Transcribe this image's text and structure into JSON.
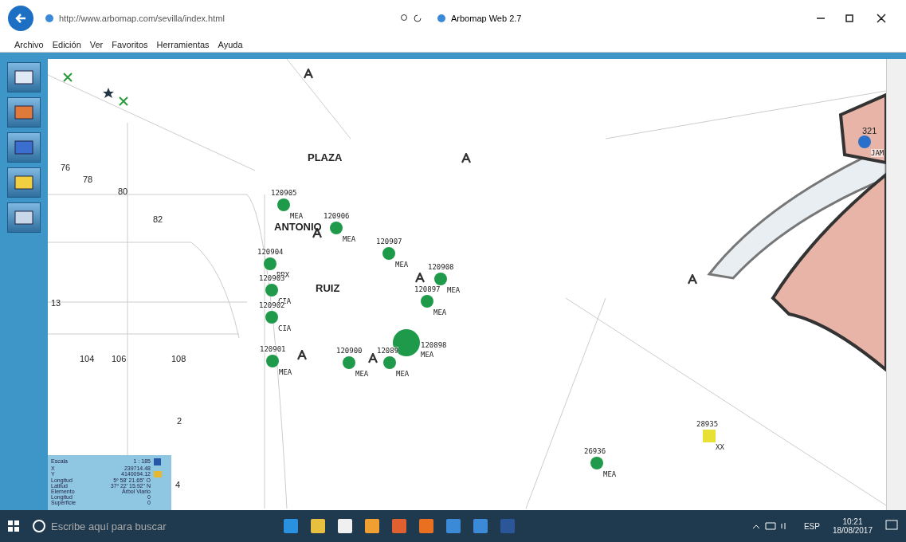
{
  "browser": {
    "address": "http://www.arbomap.com/sevilla/index.html",
    "tab_title": "Arbomap Web 2.7"
  },
  "menu": [
    "Archivo",
    "Edición",
    "Ver",
    "Favoritos",
    "Herramientas",
    "Ayuda"
  ],
  "map": {
    "labels": [
      {
        "kind": "street",
        "text": "PLAZA"
      },
      {
        "kind": "street",
        "text": "ANTONIO"
      },
      {
        "kind": "street",
        "text": "RUIZ"
      },
      {
        "kind": "number",
        "text": "76"
      },
      {
        "kind": "number",
        "text": "78"
      },
      {
        "kind": "number",
        "text": "80"
      },
      {
        "kind": "number",
        "text": "82"
      },
      {
        "kind": "number",
        "text": "13"
      },
      {
        "kind": "number",
        "text": "104"
      },
      {
        "kind": "number",
        "text": "106"
      },
      {
        "kind": "number",
        "text": "108"
      },
      {
        "kind": "number",
        "text": "2"
      },
      {
        "kind": "number",
        "text": "4"
      },
      {
        "kind": "number",
        "text": "321"
      }
    ],
    "trees": [
      {
        "kind": "circle",
        "id": "120905",
        "code": "MEA",
        "color": "#1f9a4a"
      },
      {
        "kind": "circle",
        "id": "120906",
        "code": "MEA",
        "color": "#1f9a4a"
      },
      {
        "kind": "circle",
        "id": "120907",
        "code": "MEA",
        "color": "#1f9a4a"
      },
      {
        "kind": "circle",
        "id": "120904",
        "code": "BRX",
        "color": "#1f9a4a"
      },
      {
        "kind": "circle",
        "id": "120903",
        "code": "CIA",
        "color": "#1f9a4a"
      },
      {
        "kind": "circle",
        "id": "120902",
        "code": "CIA",
        "color": "#1f9a4a"
      },
      {
        "kind": "circle",
        "id": "120908",
        "code": "MEA",
        "color": "#1f9a4a"
      },
      {
        "kind": "circle",
        "id": "120897",
        "code": "MEA",
        "color": "#1f9a4a"
      },
      {
        "kind": "large",
        "id": "120898",
        "code": "MEA",
        "color": "#1f9a4a"
      },
      {
        "kind": "circle",
        "id": "120901",
        "code": "MEA",
        "color": "#1f9a4a"
      },
      {
        "kind": "circle",
        "id": "120900",
        "code": "MEA",
        "color": "#1f9a4a"
      },
      {
        "kind": "circle",
        "id": "12089",
        "code": "MEA",
        "color": "#1f9a4a"
      },
      {
        "kind": "circle",
        "id": "26936",
        "code": "MEA",
        "color": "#1f9a4a"
      },
      {
        "kind": "square",
        "id": "28935",
        "code": "XX",
        "color": "#e8e035"
      },
      {
        "kind": "circle",
        "code": "JAM",
        "color": "#2a6fc9"
      }
    ],
    "info": [
      {
        "label": "Escala",
        "value": "1 : 185"
      },
      {
        "label": "X",
        "value": "239714.48"
      },
      {
        "label": "Y",
        "value": "4140094.12"
      },
      {
        "label": "Longitud",
        "value": "5º 58' 21.65\" O"
      },
      {
        "label": "Latitud",
        "value": "37º 22' 15.92\" N"
      },
      {
        "label": "Elemento",
        "value": "Árbol Viario"
      },
      {
        "label": "Longitud",
        "value": "0"
      },
      {
        "label": "Superficie",
        "value": "0"
      }
    ]
  },
  "taskbar": {
    "search_placeholder": "Escribe aquí para buscar",
    "language": "ESP",
    "time": "10:21",
    "date": "18/08/2017"
  }
}
